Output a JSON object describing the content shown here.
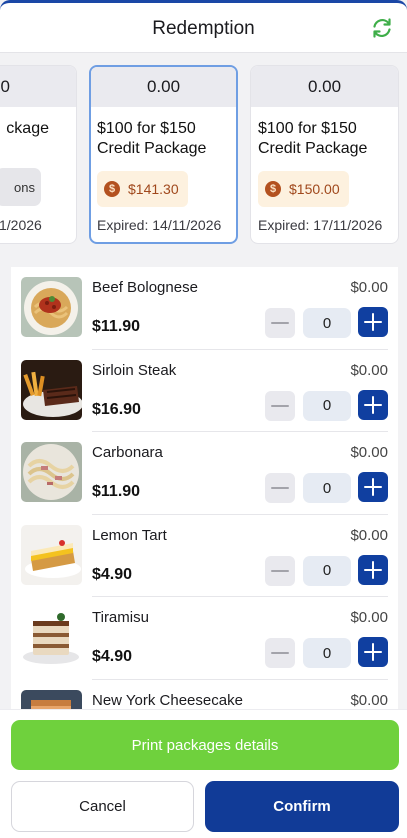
{
  "header": {
    "title": "Redemption",
    "refresh_icon": "refresh-icon"
  },
  "packages": [
    {
      "balance": "0",
      "name": "ckage",
      "chip": "ons",
      "expiry": "1/2026"
    },
    {
      "balance": "0.00",
      "name": "$100 for $150 Credit Package",
      "price": "$141.30",
      "expiry": "Expired: 14/11/2026",
      "selected": true
    },
    {
      "balance": "0.00",
      "name": "$100 for $150 Credit Package",
      "price": "$150.00",
      "expiry": "Expired: 17/11/2026"
    }
  ],
  "coin_symbol": "$",
  "items": [
    {
      "name": "Beef Bolognese",
      "price": "$11.90",
      "subtotal": "$0.00",
      "qty": "0",
      "image": "beef-bolognese-photo"
    },
    {
      "name": "Sirloin Steak",
      "price": "$16.90",
      "subtotal": "$0.00",
      "qty": "0",
      "image": "sirloin-steak-photo"
    },
    {
      "name": "Carbonara",
      "price": "$11.90",
      "subtotal": "$0.00",
      "qty": "0",
      "image": "carbonara-photo"
    },
    {
      "name": "Lemon Tart",
      "price": "$4.90",
      "subtotal": "$0.00",
      "qty": "0",
      "image": "lemon-tart-photo"
    },
    {
      "name": "Tiramisu",
      "price": "$4.90",
      "subtotal": "$0.00",
      "qty": "0",
      "image": "tiramisu-photo"
    },
    {
      "name": "New York Cheesecake",
      "price": "",
      "subtotal": "$0.00",
      "qty": "0",
      "image": "cheesecake-photo"
    }
  ],
  "footer": {
    "print_label": "Print packages details",
    "cancel_label": "Cancel",
    "confirm_label": "Confirm"
  },
  "colors": {
    "primary": "#113b97",
    "success": "#6fd13d",
    "accent_refresh": "#3fae49",
    "price_text": "#a0481c"
  }
}
